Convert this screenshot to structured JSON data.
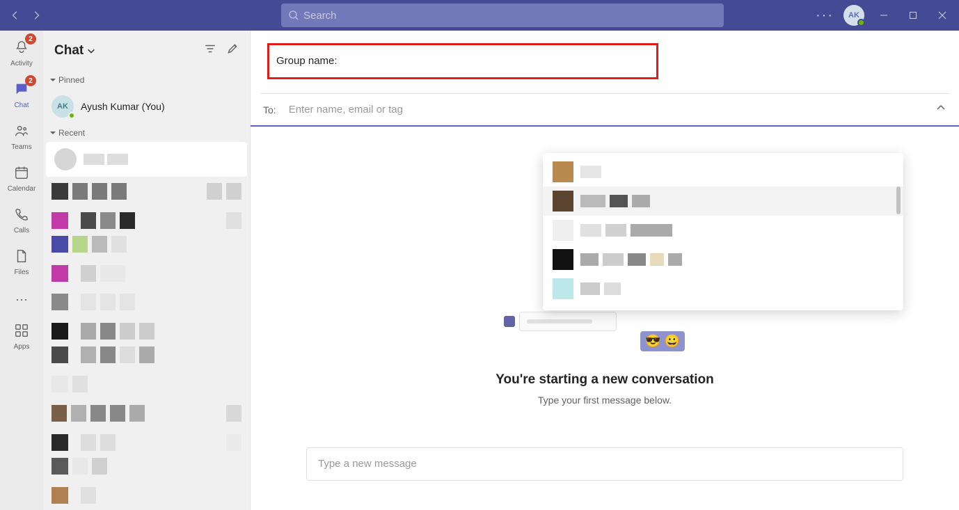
{
  "titlebar": {
    "search_placeholder": "Search",
    "avatar_initials": "AK"
  },
  "apprail": {
    "items": [
      {
        "label": "Activity",
        "badge": "2"
      },
      {
        "label": "Chat",
        "badge": "2"
      },
      {
        "label": "Teams"
      },
      {
        "label": "Calendar"
      },
      {
        "label": "Calls"
      },
      {
        "label": "Files"
      }
    ],
    "apps_label": "Apps"
  },
  "chatlist": {
    "title": "Chat",
    "pinned_label": "Pinned",
    "recent_label": "Recent",
    "self_avatar": "AK",
    "self_name": "Ayush Kumar (You)"
  },
  "main": {
    "group_name_label": "Group name:",
    "to_label": "To:",
    "to_placeholder": "Enter name, email or tag",
    "start_title": "You're starting a new conversation",
    "start_sub": "Type your first message below.",
    "compose_placeholder": "Type a new message",
    "emoji": "😎 😀"
  }
}
